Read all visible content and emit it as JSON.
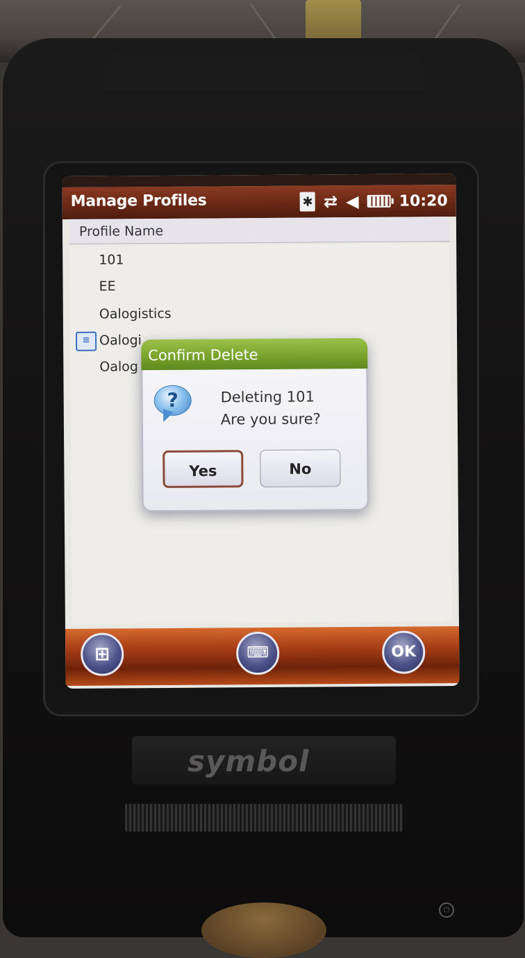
{
  "window": {
    "title": "Manage Profiles",
    "status": {
      "icons": [
        "bluetooth-icon",
        "sync-icon",
        "speaker-icon",
        "battery-icon"
      ],
      "time": "10:20"
    }
  },
  "list": {
    "column_header": "Profile Name",
    "items": [
      "101",
      "EE",
      "Oalogistics",
      "Oalogi",
      "Oalog"
    ],
    "active_item_icon": "profile-active-icon"
  },
  "dialog": {
    "title": "Confirm Delete",
    "icon": "question-icon",
    "message_line1": "Deleting 101",
    "message_line2": "Are you sure?",
    "yes_label": "Yes",
    "no_label": "No"
  },
  "softkeys": {
    "start_icon": "windows-start-icon",
    "keyboard_icon": "keyboard-icon",
    "ok_label": "OK"
  },
  "device": {
    "brand": "symbol"
  },
  "colors": {
    "titlebar": "#6a2815",
    "dialog_title": "#79a42e",
    "softbar": "#a83e16",
    "softbutton": "#4c5288"
  }
}
